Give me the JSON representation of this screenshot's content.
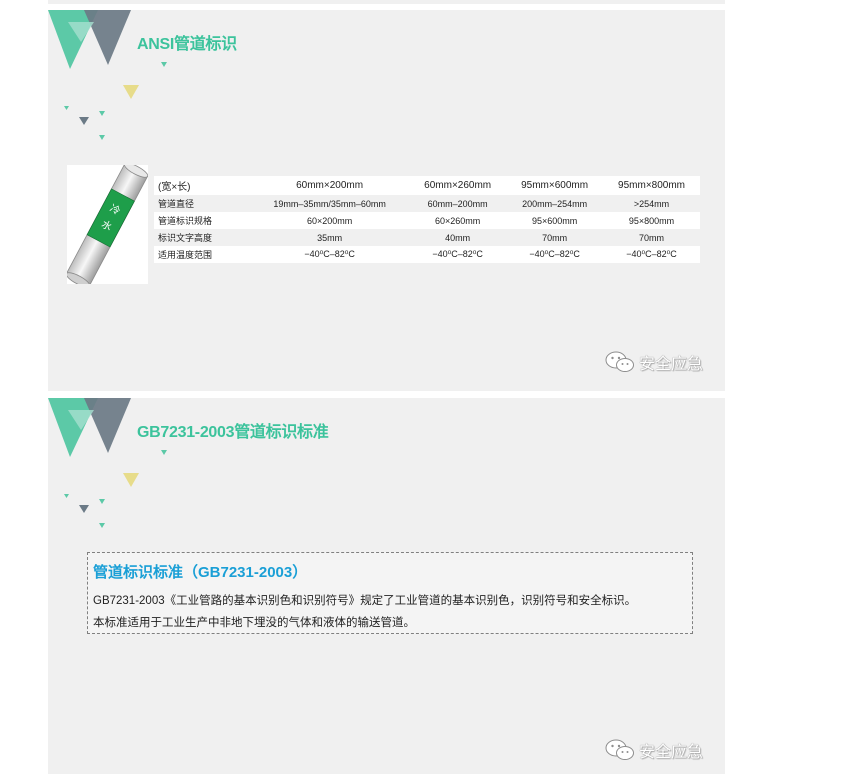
{
  "slide1": {
    "title": "ANSI管道标识",
    "pipe_label": "冷水",
    "table": {
      "header": [
        "(宽×长)",
        "60mm×200mm",
        "60mm×260mm",
        "95mm×600mm",
        "95mm×800mm"
      ],
      "rows": [
        [
          "管道直径",
          "19mm–35mm/35mm–60mm",
          "60mm–200mm",
          "200mm–254mm",
          ">254mm"
        ],
        [
          "管道标识规格",
          "60×200mm",
          "60×260mm",
          "95×600mm",
          "95×800mm"
        ],
        [
          "标识文字高度",
          "35mm",
          "40mm",
          "70mm",
          "70mm"
        ],
        [
          "适用温度范围",
          "−40⁰C–82⁰C",
          "−40⁰C–82⁰C",
          "−40⁰C–82⁰C",
          "−40⁰C–82⁰C"
        ]
      ]
    },
    "brand": "安全应急"
  },
  "slide2": {
    "title": "GB7231-2003管道标识标准",
    "box_title": "管道标识标准（GB7231-2003）",
    "box_line1": "GB7231-2003《工业管路的基本识别色和识别符号》规定了工业管道的基本识别色，识别符号和安全标识。",
    "box_line2": "本标准适用于工业生产中非地下埋没的气体和液体的输送管道。",
    "brand": "安全应急"
  },
  "colors": {
    "title_green": "#3cc39c",
    "box_title_blue": "#1a9fd6",
    "slide_bg": "#f0f0f0",
    "pipe_band_green": "#1e9e4a",
    "deco_green": "#5cc9a7",
    "deco_gray": "#6b7a86",
    "deco_yellow": "#e7dc8a"
  },
  "icons": [
    "decorative-triangles",
    "pipe-illustration",
    "wechat-icon"
  ]
}
